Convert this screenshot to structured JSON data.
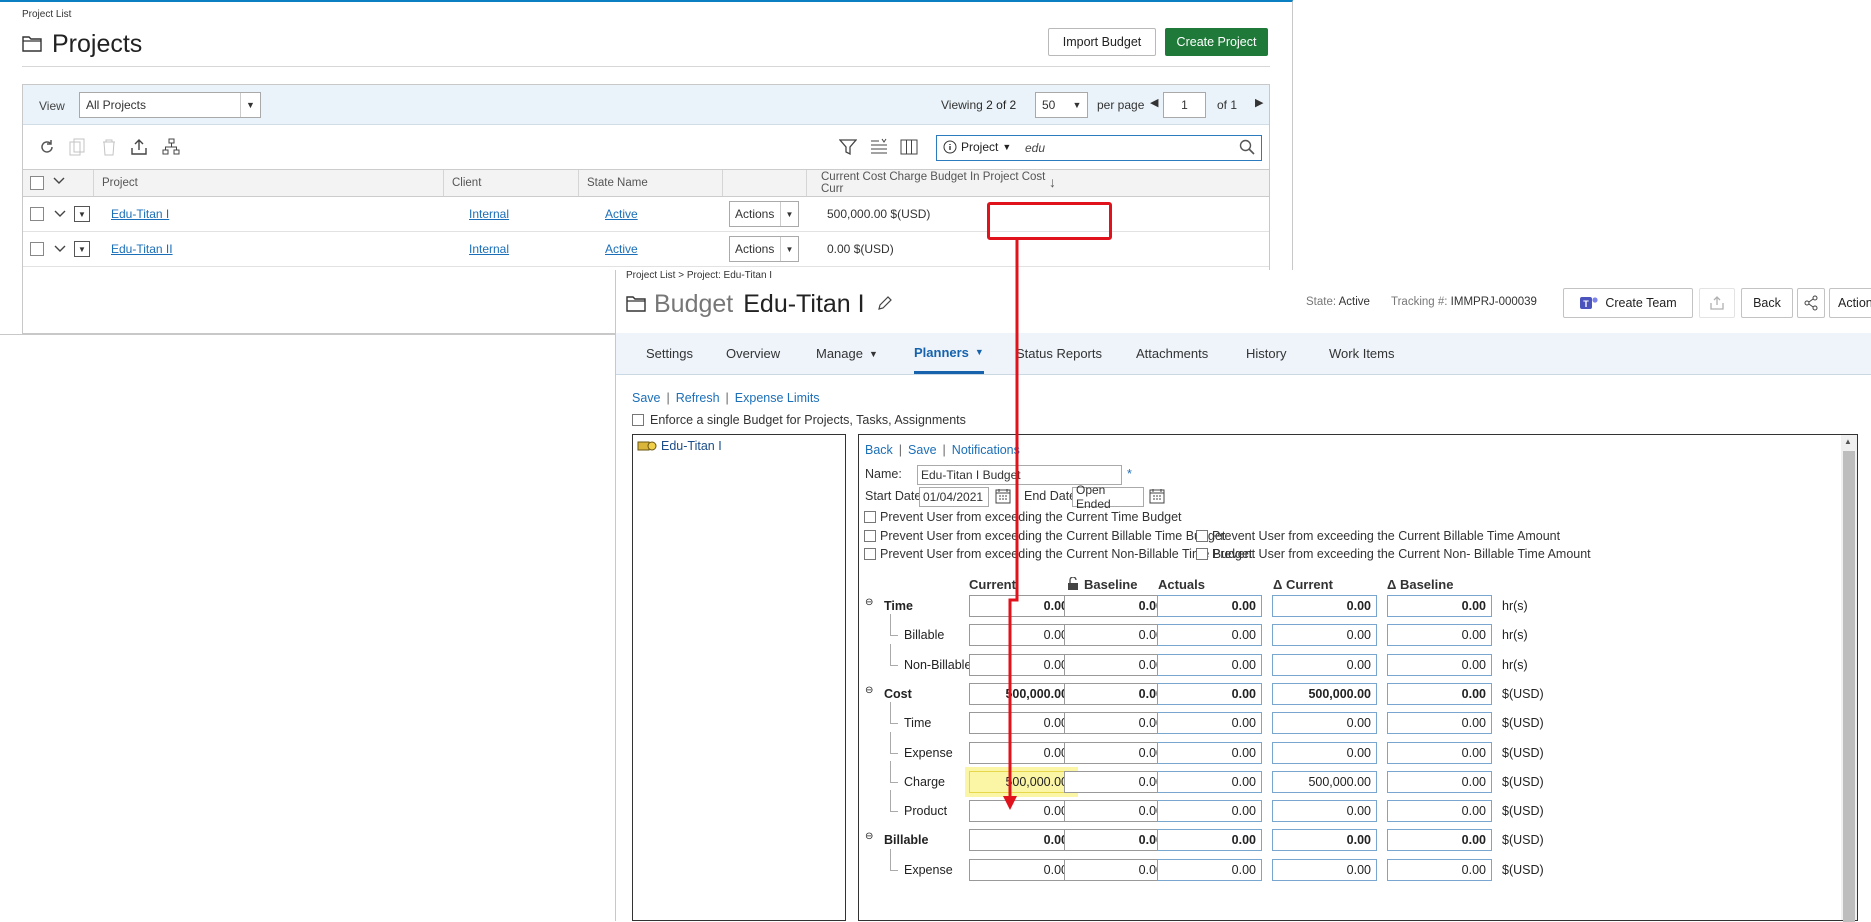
{
  "project_list": {
    "breadcrumb": "Project List",
    "title": "Projects",
    "import_button": "Import Budget",
    "create_button": "Create Project",
    "view_label": "View",
    "view_value": "All Projects",
    "viewing_prefix": "Viewing",
    "viewing_count": "2 of 2",
    "per_page_value": "50",
    "per_page_label": "per page",
    "page_value": "1",
    "page_of": "of 1",
    "search_scope": "Project",
    "search_text": "edu",
    "columns": [
      "Project",
      "Client",
      "State Name",
      "Current Cost Charge Budget In Project Cost Curr"
    ],
    "rows": [
      {
        "project": "Edu-Titan I",
        "client": "Internal",
        "state": "Active",
        "actions": "Actions",
        "budget": "500,000.00 $(USD)"
      },
      {
        "project": "Edu-Titan II",
        "client": "Internal",
        "state": "Active",
        "actions": "Actions",
        "budget": "0.00 $(USD)"
      }
    ]
  },
  "budget": {
    "breadcrumb": "Project List > Project: Edu-Titan I",
    "title_prefix": "Budget",
    "title": "Edu-Titan I",
    "state_label": "State:",
    "state_value": "Active",
    "tracking_label": "Tracking #:",
    "tracking_value": "IMMPRJ-000039",
    "create_team": "Create Team",
    "back": "Back",
    "actions": "Actions",
    "tabs": [
      "Settings",
      "Overview",
      "Manage",
      "Planners",
      "Status Reports",
      "Attachments",
      "History",
      "Work Items"
    ],
    "links": [
      "Save",
      "Refresh",
      "Expense Limits"
    ],
    "enforce_label": "Enforce a single Budget for Projects, Tasks, Assignments",
    "tree_item": "Edu-Titan I",
    "editor_links": [
      "Back",
      "Save",
      "Notifications"
    ],
    "name_label": "Name:",
    "name_value": "Edu-Titan I Budget",
    "required_mark": "*",
    "start_label": "Start Date:",
    "start_value": "01/04/2021",
    "end_label": "End Date:",
    "end_value": "Open Ended",
    "checks": [
      "Prevent User from exceeding the Current Time Budget",
      "Prevent User from exceeding the Current Billable Time Budget",
      "Prevent User from exceeding the Current Billable Time Amount",
      "Prevent User from exceeding the Current Non-Billable Time Budget",
      "Prevent User from exceeding the Current Non- Billable Time Amount"
    ],
    "columns": [
      "Current",
      "Baseline",
      "Actuals",
      "Δ Current",
      "Δ Baseline"
    ],
    "rows": [
      {
        "label": "Time",
        "group": true,
        "values": [
          "0.00",
          "0.00",
          "0.00",
          "0.00",
          "0.00"
        ],
        "unit": "hr(s)"
      },
      {
        "label": "Billable",
        "group": false,
        "values": [
          "0.00",
          "0.00",
          "0.00",
          "0.00",
          "0.00"
        ],
        "unit": "hr(s)"
      },
      {
        "label": "Non-Billable",
        "group": false,
        "values": [
          "0.00",
          "0.00",
          "0.00",
          "0.00",
          "0.00"
        ],
        "unit": "hr(s)"
      },
      {
        "label": "Cost",
        "group": true,
        "values": [
          "500,000.00",
          "0.00",
          "0.00",
          "500,000.00",
          "0.00"
        ],
        "unit": "$(USD)"
      },
      {
        "label": "Time",
        "group": false,
        "values": [
          "0.00",
          "0.00",
          "0.00",
          "0.00",
          "0.00"
        ],
        "unit": "$(USD)"
      },
      {
        "label": "Expense",
        "group": false,
        "values": [
          "0.00",
          "0.00",
          "0.00",
          "0.00",
          "0.00"
        ],
        "unit": "$(USD)"
      },
      {
        "label": "Charge",
        "group": false,
        "highlight": true,
        "values": [
          "500,000.00",
          "0.00",
          "0.00",
          "500,000.00",
          "0.00"
        ],
        "unit": "$(USD)"
      },
      {
        "label": "Product",
        "group": false,
        "values": [
          "0.00",
          "0.00",
          "0.00",
          "0.00",
          "0.00"
        ],
        "unit": "$(USD)"
      },
      {
        "label": "Billable",
        "group": true,
        "values": [
          "0.00",
          "0.00",
          "0.00",
          "0.00",
          "0.00"
        ],
        "unit": "$(USD)"
      },
      {
        "label": "Expense",
        "group": false,
        "values": [
          "0.00",
          "0.00",
          "0.00",
          "0.00",
          "0.00"
        ],
        "unit": "$(USD)"
      }
    ]
  },
  "colors": {
    "accent": "#1662ad",
    "create_button": "#1f7a3a",
    "annotation": "#e0121b",
    "highlight": "#fbf5a6"
  }
}
